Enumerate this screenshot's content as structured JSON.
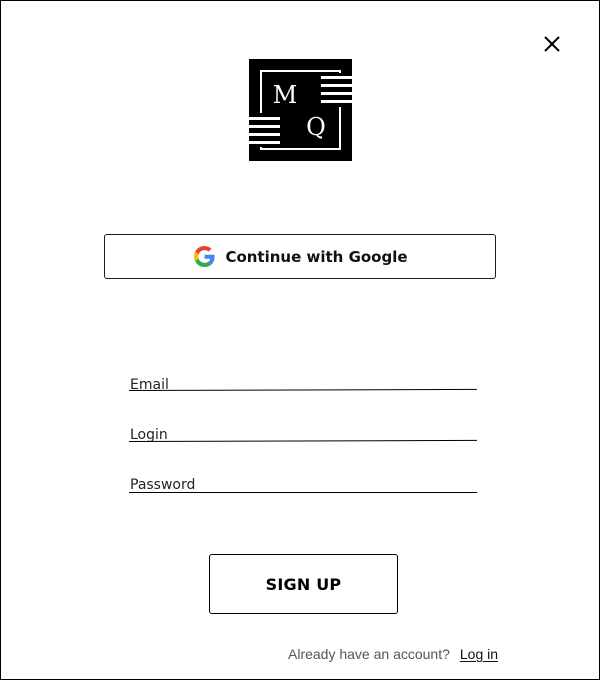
{
  "dialog": {
    "close_label": "close-icon"
  },
  "logo": {
    "letter_top": "M",
    "letter_bottom": "Q"
  },
  "google_button": {
    "label": "Continue with Google",
    "icon": "google-icon"
  },
  "form": {
    "email_placeholder": "Email",
    "login_placeholder": "Login",
    "password_placeholder": "Password"
  },
  "signup_button": {
    "label": "SIGN UP"
  },
  "footer": {
    "prompt": "Already have an account?",
    "login_link": "Log in"
  },
  "colors": {
    "text": "#000000",
    "muted_text": "#555555",
    "border": "#000000",
    "background": "#ffffff",
    "google_blue": "#4285F4",
    "google_red": "#EA4335",
    "google_yellow": "#FBBC05",
    "google_green": "#34A853"
  }
}
